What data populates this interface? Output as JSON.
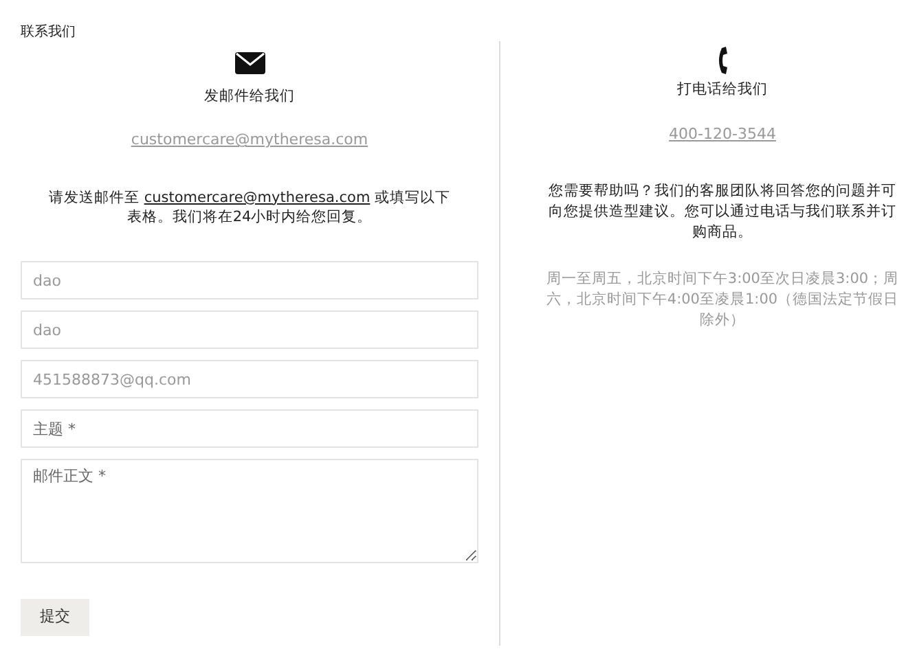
{
  "page_title": "联系我们",
  "email_section": {
    "heading": "发邮件给我们",
    "email": "customercare@mytheresa.com",
    "intro": {
      "before": "请发送邮件至 ",
      "link": "customercare@mytheresa.com",
      "after": " 或填写以下表格。我们将在24小时内给您回复。"
    }
  },
  "form": {
    "fields": [
      {
        "kind": "input",
        "value": "dao"
      },
      {
        "kind": "input",
        "value": "dao"
      },
      {
        "kind": "input",
        "value": "451588873@qq.com"
      },
      {
        "kind": "input",
        "placeholder": "主题 *"
      },
      {
        "kind": "textarea",
        "placeholder": "邮件正文 *"
      }
    ],
    "submit": "提交"
  },
  "phone_section": {
    "heading": "打电话给我们",
    "phone": "400-120-3544",
    "intro": "您需要帮助吗？我们的客服团队将回答您的问题并可向您提供造型建议。您可以通过电话与我们联系并订购商品。",
    "hours": "周一至周五，北京时间下午3:00至次日凌晨3:00；周六，北京时间下午4:00至凌晨1:00（德国法定节假日除外）"
  }
}
